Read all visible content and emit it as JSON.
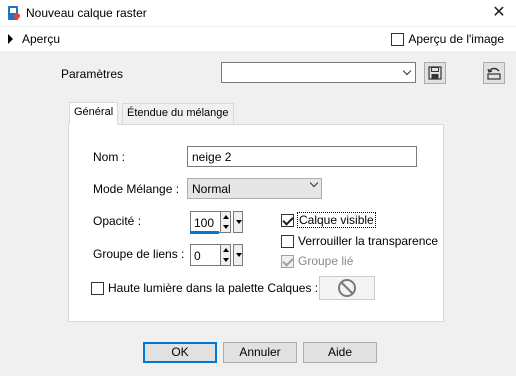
{
  "window": {
    "title": "Nouveau calque raster",
    "icon": "app-icon",
    "close_glyph": "✕"
  },
  "apercu": {
    "label": "Aperçu",
    "image_label": "Aperçu de l'image",
    "image_checked": false
  },
  "parametres": {
    "label": "Paramètres",
    "value": ""
  },
  "tabs": [
    {
      "label": "Général",
      "active": true
    },
    {
      "label": "Étendue du mélange",
      "active": false
    }
  ],
  "general": {
    "nom_label": "Nom :",
    "nom_value": "neige 2",
    "mode_label": "Mode Mélange :",
    "mode_value": "Normal",
    "opacite_label": "Opacité :",
    "opacite_value": "100",
    "groupe_label": "Groupe de liens :",
    "groupe_value": "0",
    "calque_visible_label": "Calque visible",
    "calque_visible_checked": true,
    "verrouiller_label": "Verrouiller la transparence",
    "verrouiller_checked": false,
    "groupe_lie_label": "Groupe lié",
    "groupe_lie_checked": true,
    "haute_lumiere_label": "Haute lumière dans la palette Calques :",
    "haute_lumiere_checked": false
  },
  "buttons": {
    "ok": "OK",
    "annuler": "Annuler",
    "aide": "Aide"
  },
  "colors": {
    "accent": "#0078d7",
    "background": "#f0f0f0",
    "panel": "#ffffff"
  }
}
